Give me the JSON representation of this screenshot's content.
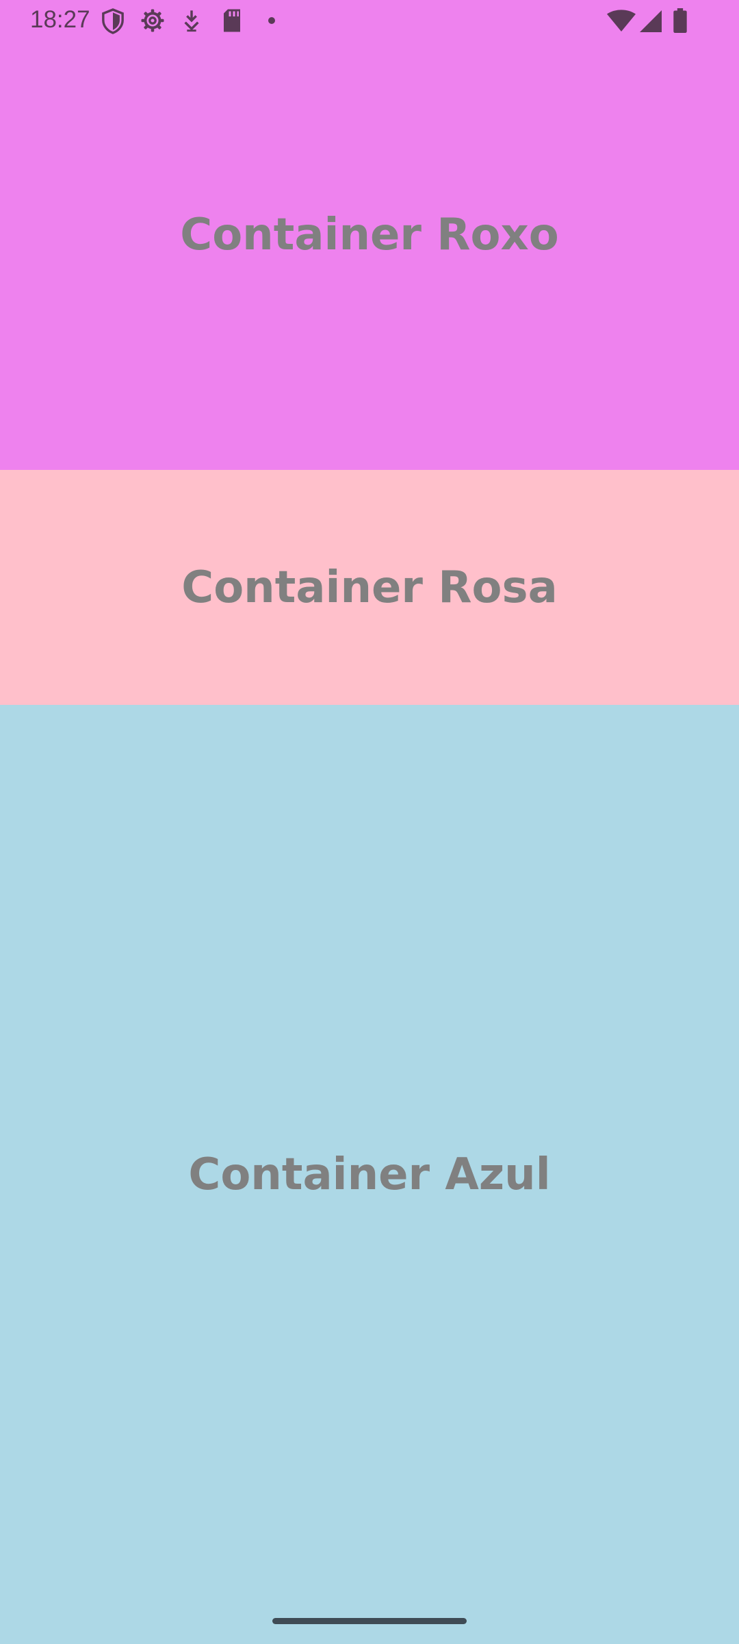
{
  "status_bar": {
    "time": "18:27",
    "icons": [
      "shield-icon",
      "settings-gear-icon",
      "download-icon",
      "sd-card-icon",
      "dot-icon",
      "wifi-icon",
      "signal-icon",
      "battery-icon"
    ]
  },
  "containers": [
    {
      "label": "Container Roxo",
      "color": "#ee82ee"
    },
    {
      "label": "Container Rosa",
      "color": "#ffc0cb"
    },
    {
      "label": "Container Azul",
      "color": "#add8e6"
    }
  ],
  "colors": {
    "label_text": "#808080",
    "status_icons": "#5a3a57",
    "nav_handle": "#3f4b55"
  }
}
